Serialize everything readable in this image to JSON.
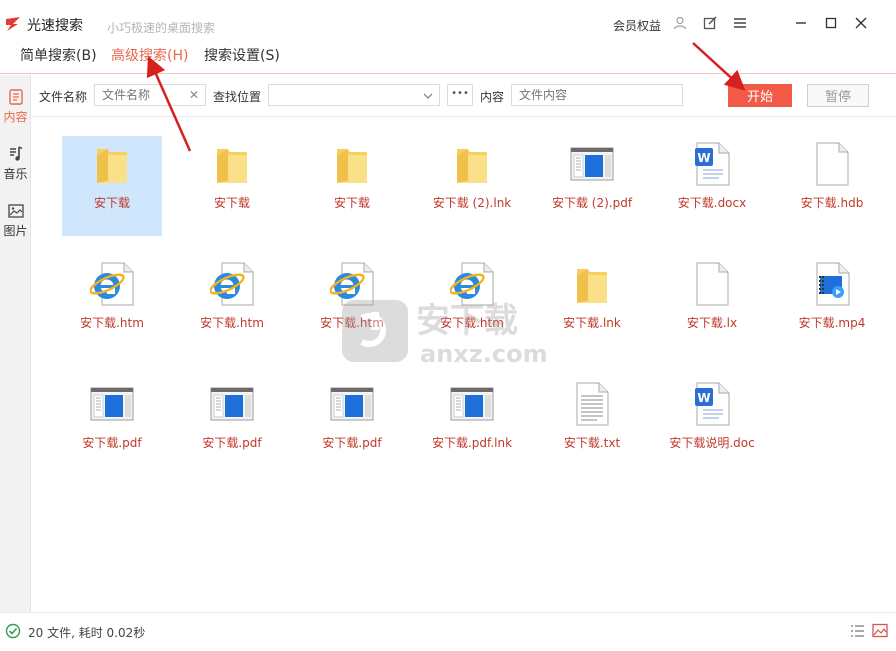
{
  "app": {
    "title": "光速搜索",
    "slogan": "小巧极速的桌面搜索",
    "member_label": "会员权益"
  },
  "menu": [
    {
      "label": "简单搜索(B)",
      "active": false
    },
    {
      "label": "高级搜索(H)",
      "active": true
    },
    {
      "label": "搜索设置(S)",
      "active": false
    }
  ],
  "sidebar": [
    {
      "label": "内容",
      "icon": "document-icon",
      "active": true
    },
    {
      "label": "音乐",
      "icon": "music-icon",
      "active": false
    },
    {
      "label": "图片",
      "icon": "image-icon",
      "active": false
    }
  ],
  "search": {
    "filename_label": "文件名称",
    "filename_placeholder": "文件名称",
    "location_label": "查找位置",
    "location_value": "",
    "more_label": "•••",
    "content_label": "内容",
    "content_placeholder": "文件内容",
    "start_label": "开始",
    "pause_label": "暂停"
  },
  "files": [
    {
      "name": "安下载",
      "type": "folder",
      "selected": true
    },
    {
      "name": "安下载",
      "type": "folder"
    },
    {
      "name": "安下载",
      "type": "folder"
    },
    {
      "name": "安下载 (2).lnk",
      "type": "folder"
    },
    {
      "name": "安下载 (2).pdf",
      "type": "window"
    },
    {
      "name": "安下载.docx",
      "type": "word"
    },
    {
      "name": "安下载.hdb",
      "type": "blank"
    },
    {
      "name": "安下载.htm",
      "type": "ie"
    },
    {
      "name": "安下载.htm",
      "type": "ie"
    },
    {
      "name": "安下载.htm",
      "type": "ie"
    },
    {
      "name": "安下载.htm",
      "type": "ie"
    },
    {
      "name": "安下载.lnk",
      "type": "folder"
    },
    {
      "name": "安下载.lx",
      "type": "blank"
    },
    {
      "name": "安下载.mp4",
      "type": "video"
    },
    {
      "name": "安下载.pdf",
      "type": "window"
    },
    {
      "name": "安下载.pdf",
      "type": "window"
    },
    {
      "name": "安下载.pdf",
      "type": "window"
    },
    {
      "name": "安下载.pdf.lnk",
      "type": "window"
    },
    {
      "name": "安下载.txt",
      "type": "text"
    },
    {
      "name": "安下载说明.doc",
      "type": "word"
    }
  ],
  "watermark": {
    "line1": "安下载",
    "line2": "anxz.com"
  },
  "status": {
    "text": "20 文件, 耗时 0.02秒"
  },
  "colors": {
    "accent": "#e86a4a",
    "start_button": "#f25a47",
    "file_name": "#c0392b",
    "selection": "#cfe6fd"
  }
}
